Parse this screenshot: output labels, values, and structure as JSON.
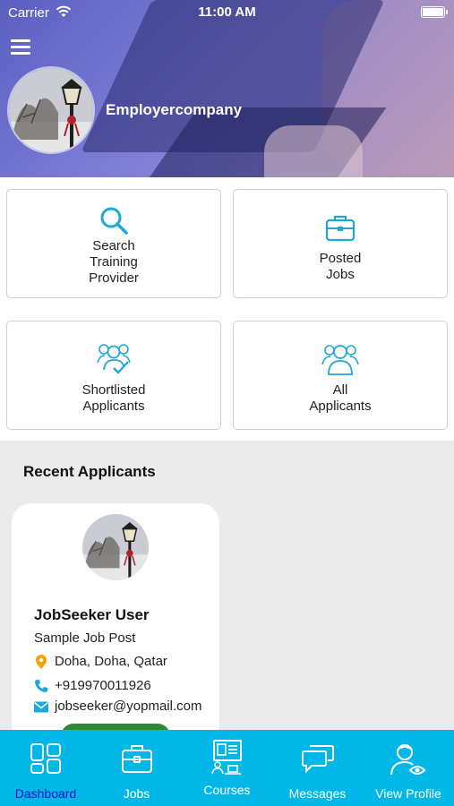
{
  "status_bar": {
    "carrier": "Carrier",
    "time": "11:00 AM"
  },
  "header": {
    "company_name": "Employercompany"
  },
  "tiles": [
    {
      "label": "Search\nTraining\nProvider",
      "icon": "search-icon"
    },
    {
      "label": "Posted\nJobs",
      "icon": "briefcase-icon"
    },
    {
      "label": "Shortlisted\nApplicants",
      "icon": "shortlisted-users-icon"
    },
    {
      "label": "All\nApplicants",
      "icon": "users-icon"
    }
  ],
  "recent": {
    "title": "Recent Applicants",
    "applicant": {
      "name": "JobSeeker User",
      "job": "Sample Job Post",
      "location": "Doha, Doha, Qatar",
      "phone": "+919970011926",
      "email": "jobseeker@yopmail.com"
    }
  },
  "tabbar": {
    "tabs": [
      {
        "label": "Dashboard",
        "icon": "dashboard-icon",
        "active": true
      },
      {
        "label": "Jobs",
        "icon": "briefcase-icon"
      },
      {
        "label": "Courses",
        "icon": "courses-icon"
      },
      {
        "label": "Messages",
        "icon": "messages-icon"
      },
      {
        "label": "View Profile",
        "icon": "profile-icon"
      }
    ]
  },
  "colors": {
    "tabbar": "#00b7e8",
    "active_tab": "#1414c8",
    "icon_accent": "#1ca9d8",
    "location_pin": "#f5a300",
    "button_green": "#2f8a2f"
  }
}
